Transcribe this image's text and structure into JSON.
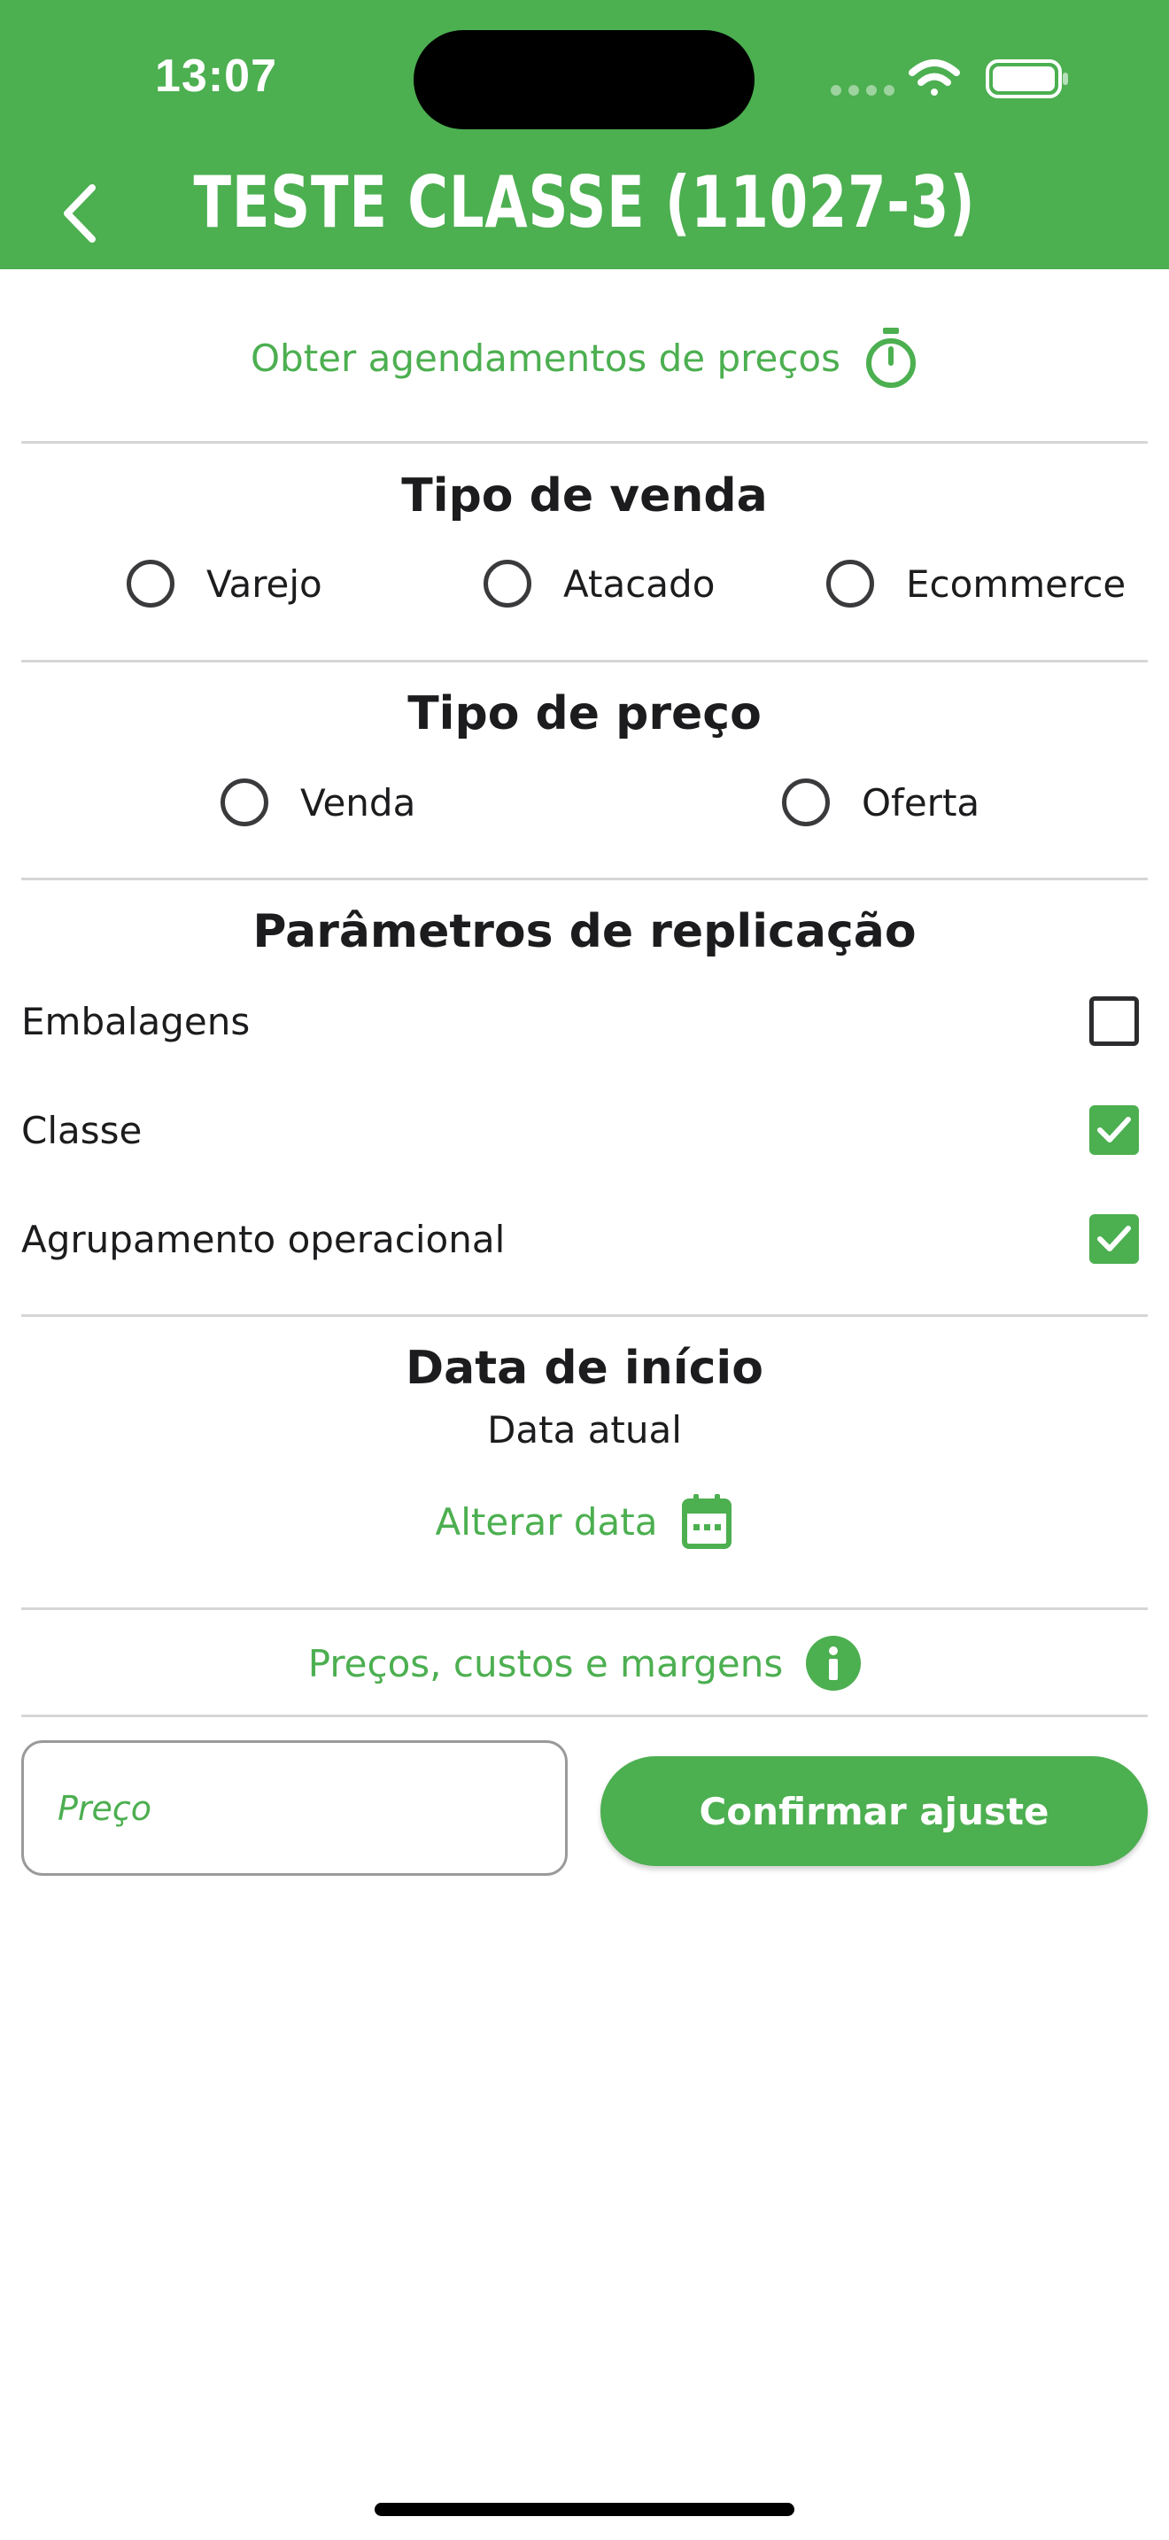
{
  "status_bar": {
    "time": "13:07"
  },
  "header": {
    "title": "TESTE CLASSE (11027-3)"
  },
  "schedule_link": {
    "label": "Obter agendamentos de preços",
    "icon": "stopwatch-icon"
  },
  "sale_type": {
    "title": "Tipo de venda",
    "options": [
      "Varejo",
      "Atacado",
      "Ecommerce"
    ]
  },
  "price_type": {
    "title": "Tipo de preço",
    "options": [
      "Venda",
      "Oferta"
    ]
  },
  "replication": {
    "title": "Parâmetros de replicação",
    "items": [
      {
        "label": "Embalagens",
        "checked": false
      },
      {
        "label": "Classe",
        "checked": true
      },
      {
        "label": "Agrupamento operacional",
        "checked": true
      }
    ]
  },
  "start_date": {
    "title": "Data de início",
    "value": "Data atual",
    "change_label": "Alterar data"
  },
  "prices_link": {
    "label": "Preços, custos e margens"
  },
  "price_input": {
    "placeholder": "Preço",
    "value": ""
  },
  "confirm_button": {
    "label": "Confirmar ajuste"
  },
  "colors": {
    "accent": "#4caf50",
    "text": "#1c1c1e",
    "divider": "#d6d6d6"
  }
}
